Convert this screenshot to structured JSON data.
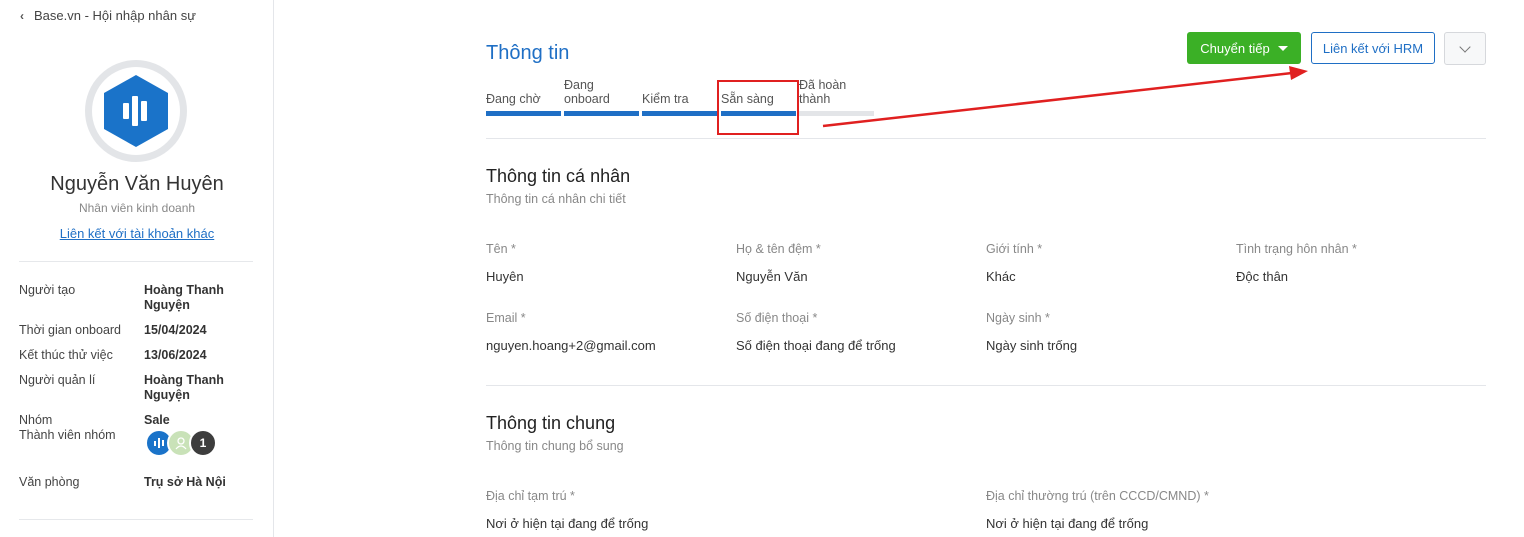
{
  "sidebar": {
    "back_label": "Base.vn - Hội nhập nhân sự",
    "user_name": "Nguyễn Văn Huyên",
    "user_role": "Nhân viên kinh doanh",
    "link_accounts": "Liên kết với tài khoản khác",
    "rows": [
      {
        "label": "Người tạo",
        "value": "Hoàng Thanh Nguyện"
      },
      {
        "label": "Thời gian onboard",
        "value": "15/04/2024"
      },
      {
        "label": "Kết thúc thử việc",
        "value": "13/06/2024"
      },
      {
        "label": "Người quản lí",
        "value": "Hoàng Thanh Nguyện"
      },
      {
        "label": "Nhóm",
        "value": "Sale"
      },
      {
        "label": "Thành viên nhóm",
        "value": ""
      },
      {
        "label": "Văn phòng",
        "value": "Trụ sở Hà Nội"
      }
    ],
    "member_overflow_count": "1"
  },
  "header": {
    "title": "Thông tin",
    "forward_button": "Chuyển tiếp",
    "hrm_button": "Liên kết với HRM"
  },
  "steps": [
    {
      "label": "Đang chờ",
      "done": true
    },
    {
      "label": "Đang onboard",
      "done": true
    },
    {
      "label": "Kiểm tra",
      "done": true
    },
    {
      "label": "Sẵn sàng",
      "done": true
    },
    {
      "label": "Đã hoàn thành",
      "done": false
    }
  ],
  "personal": {
    "title": "Thông tin cá nhân",
    "subtitle": "Thông tin cá nhân chi tiết",
    "fields": [
      {
        "label": "Tên *",
        "value": "Huyên"
      },
      {
        "label": "Họ & tên đệm *",
        "value": "Nguyễn Văn"
      },
      {
        "label": "Giới tính *",
        "value": "Khác"
      },
      {
        "label": "Tình trạng hôn nhân *",
        "value": "Độc thân"
      },
      {
        "label": "Email *",
        "value": "nguyen.hoang+2@gmail.com"
      },
      {
        "label": "Số điện thoại *",
        "value": "Số điện thoại đang để trống"
      },
      {
        "label": "Ngày sinh *",
        "value": "Ngày sinh trống"
      }
    ]
  },
  "general": {
    "title": "Thông tin chung",
    "subtitle": "Thông tin chung bổ sung",
    "fields": [
      {
        "label": "Địa chỉ tạm trú *",
        "value": "Nơi ở hiện tại đang để trống"
      },
      {
        "label": "Địa chỉ thường trú (trên CCCD/CMND) *",
        "value": "Nơi ở hiện tại đang để trống"
      }
    ]
  },
  "colors": {
    "accent": "#1f6fc5",
    "success": "#3bb026",
    "annotation": "#e02020"
  }
}
